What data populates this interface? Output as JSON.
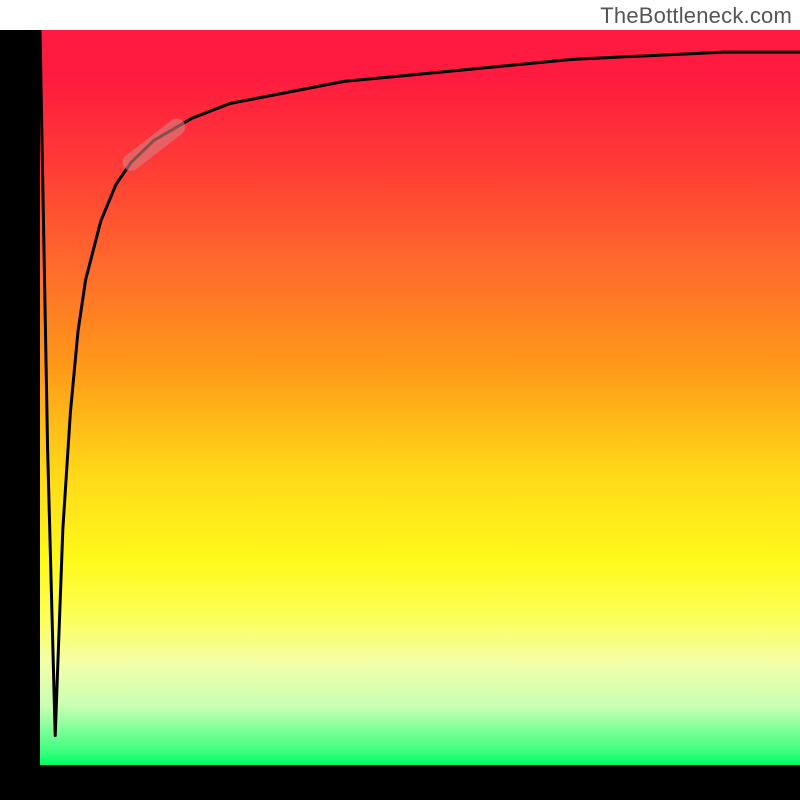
{
  "attribution": "TheBottleneck.com",
  "chart_data": {
    "type": "line",
    "title": "",
    "xlabel": "",
    "ylabel": "",
    "xlim": [
      0,
      100
    ],
    "ylim": [
      0,
      100
    ],
    "grid": false,
    "legend": false,
    "series": [
      {
        "name": "bottleneck-curve",
        "x": [
          0,
          1,
          2,
          3,
          4,
          5,
          6,
          8,
          10,
          12,
          15,
          20,
          25,
          30,
          40,
          50,
          60,
          70,
          80,
          90,
          100
        ],
        "values": [
          100,
          43,
          4,
          32,
          48,
          59,
          66,
          74,
          79,
          82,
          85,
          88,
          90,
          91,
          93,
          94,
          95,
          96,
          96.5,
          97,
          97
        ]
      }
    ],
    "annotations": [
      {
        "name": "highlight-marker",
        "x_range": [
          12,
          18
        ],
        "y_range": [
          82,
          86
        ],
        "color": "#d87e7e",
        "opacity": 0.62
      }
    ],
    "background_gradient_stops": [
      {
        "pos": 0.0,
        "color": "#ff1a3f"
      },
      {
        "pos": 0.46,
        "color": "#ff9a18"
      },
      {
        "pos": 0.72,
        "color": "#fff91a"
      },
      {
        "pos": 0.98,
        "color": "#3fff80"
      },
      {
        "pos": 1.0,
        "color": "#00ff66"
      }
    ]
  }
}
